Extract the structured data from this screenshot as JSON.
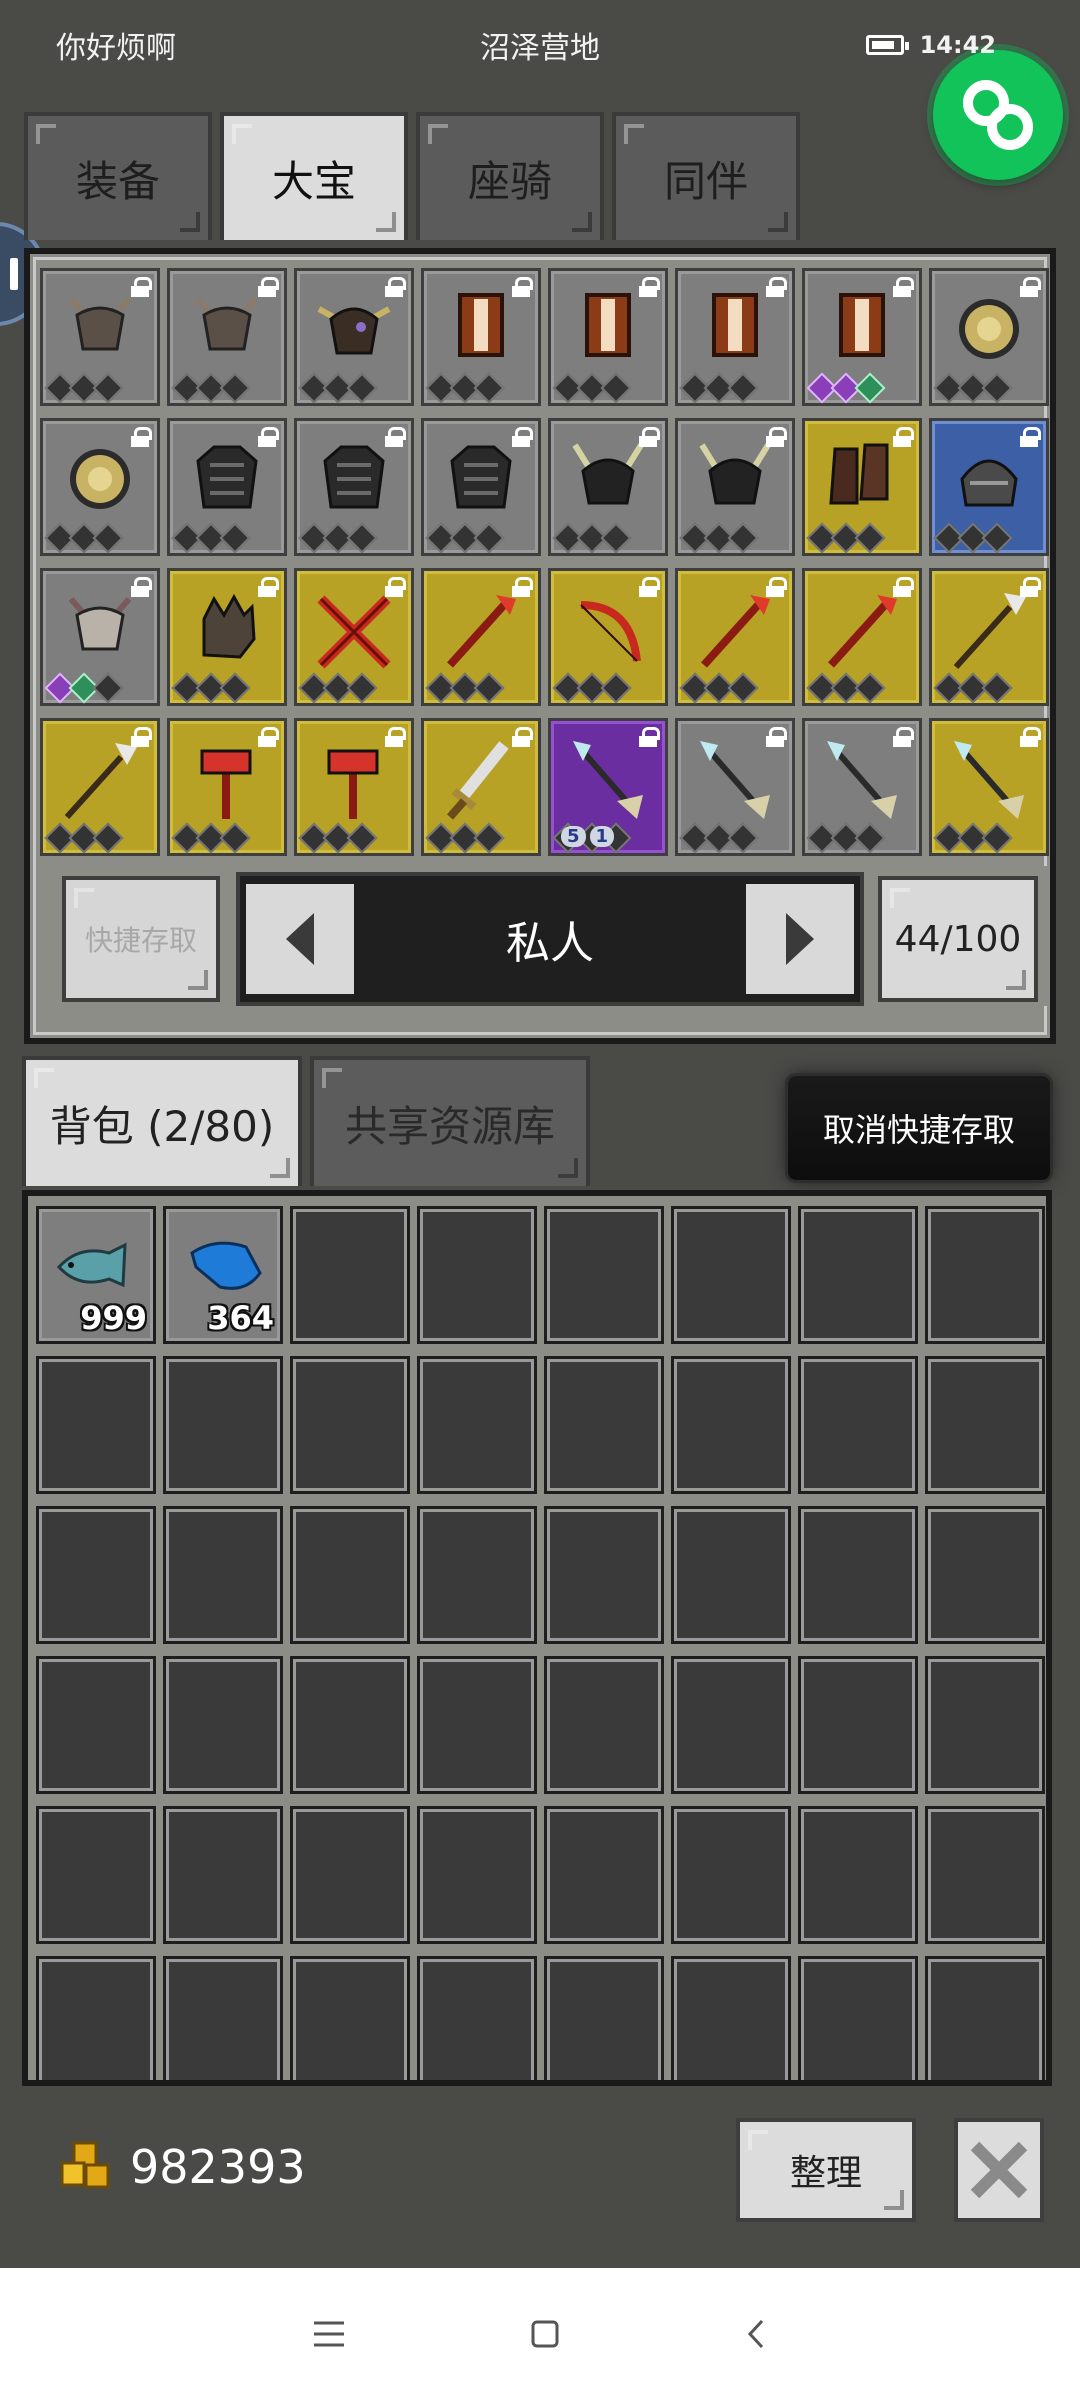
{
  "status_bar": {
    "left_text": "你好烦啊",
    "center_title": "沼泽营地",
    "time": "14:42"
  },
  "top_tabs": [
    "装备",
    "大宝",
    "座骑",
    "同伴"
  ],
  "active_top_tab": 1,
  "storage": {
    "items": [
      {
        "icon": "wolf-helmet-icon",
        "bg": "gray"
      },
      {
        "icon": "wolf-helmet-icon",
        "bg": "gray"
      },
      {
        "icon": "horned-helmet-icon",
        "bg": "gray"
      },
      {
        "icon": "brown-shield-icon",
        "bg": "gray"
      },
      {
        "icon": "brown-shield-icon",
        "bg": "gray"
      },
      {
        "icon": "brown-shield-icon",
        "bg": "gray"
      },
      {
        "icon": "brown-shield-icon",
        "bg": "gray",
        "gems": [
          "p",
          "p",
          "g"
        ]
      },
      {
        "icon": "round-gold-shield-icon",
        "bg": "gray"
      },
      {
        "icon": "round-gold-shield-icon",
        "bg": "gray"
      },
      {
        "icon": "dark-chest-armor-icon",
        "bg": "gray"
      },
      {
        "icon": "dark-chest-armor-icon",
        "bg": "gray"
      },
      {
        "icon": "dark-chest-armor-icon",
        "bg": "gray"
      },
      {
        "icon": "horned-dark-helmet-icon",
        "bg": "gray"
      },
      {
        "icon": "horned-dark-helmet-icon",
        "bg": "gray"
      },
      {
        "icon": "leather-boots-icon",
        "bg": "yellow"
      },
      {
        "icon": "iron-helmet-icon",
        "bg": "blue"
      },
      {
        "icon": "white-wolf-helmet-icon",
        "bg": "gray",
        "gems": [
          "p",
          "g"
        ]
      },
      {
        "icon": "gauntlet-icon",
        "bg": "yellow"
      },
      {
        "icon": "crossed-swords-icon",
        "bg": "yellow"
      },
      {
        "icon": "red-spear-icon",
        "bg": "yellow"
      },
      {
        "icon": "red-bow-icon",
        "bg": "yellow"
      },
      {
        "icon": "red-staff-icon",
        "bg": "yellow"
      },
      {
        "icon": "red-staff-icon",
        "bg": "yellow"
      },
      {
        "icon": "silver-spear-icon",
        "bg": "yellow"
      },
      {
        "icon": "silver-spear-icon",
        "bg": "yellow"
      },
      {
        "icon": "red-hammer-icon",
        "bg": "yellow"
      },
      {
        "icon": "red-hammer-icon",
        "bg": "yellow"
      },
      {
        "icon": "broad-sword-icon",
        "bg": "yellow"
      },
      {
        "icon": "ice-spear-icon",
        "bg": "purple",
        "badges": [
          "5",
          "1"
        ]
      },
      {
        "icon": "ice-spear-icon",
        "bg": "gray"
      },
      {
        "icon": "ice-spear-icon",
        "bg": "gray"
      },
      {
        "icon": "ice-spear-icon",
        "bg": "yellow"
      }
    ],
    "quick_access_label": "快捷存取",
    "page_label": "私人",
    "capacity": "44/100"
  },
  "bag_tabs": [
    "背包 (2/80)",
    "共享资源库"
  ],
  "active_bag_tab": 0,
  "cancel_quick_label": "取消快捷存取",
  "bag": {
    "total_slots": 48,
    "items": [
      {
        "icon": "gray-fish-icon",
        "count": "999"
      },
      {
        "icon": "blue-fish-icon",
        "count": "364"
      }
    ]
  },
  "gold": "982393",
  "sort_label": "整理",
  "colors": {
    "slot_yellow": "#b8a225",
    "slot_blue": "#3d5fa6",
    "slot_purple": "#6a2ea0",
    "float_green": "#12c35a"
  }
}
